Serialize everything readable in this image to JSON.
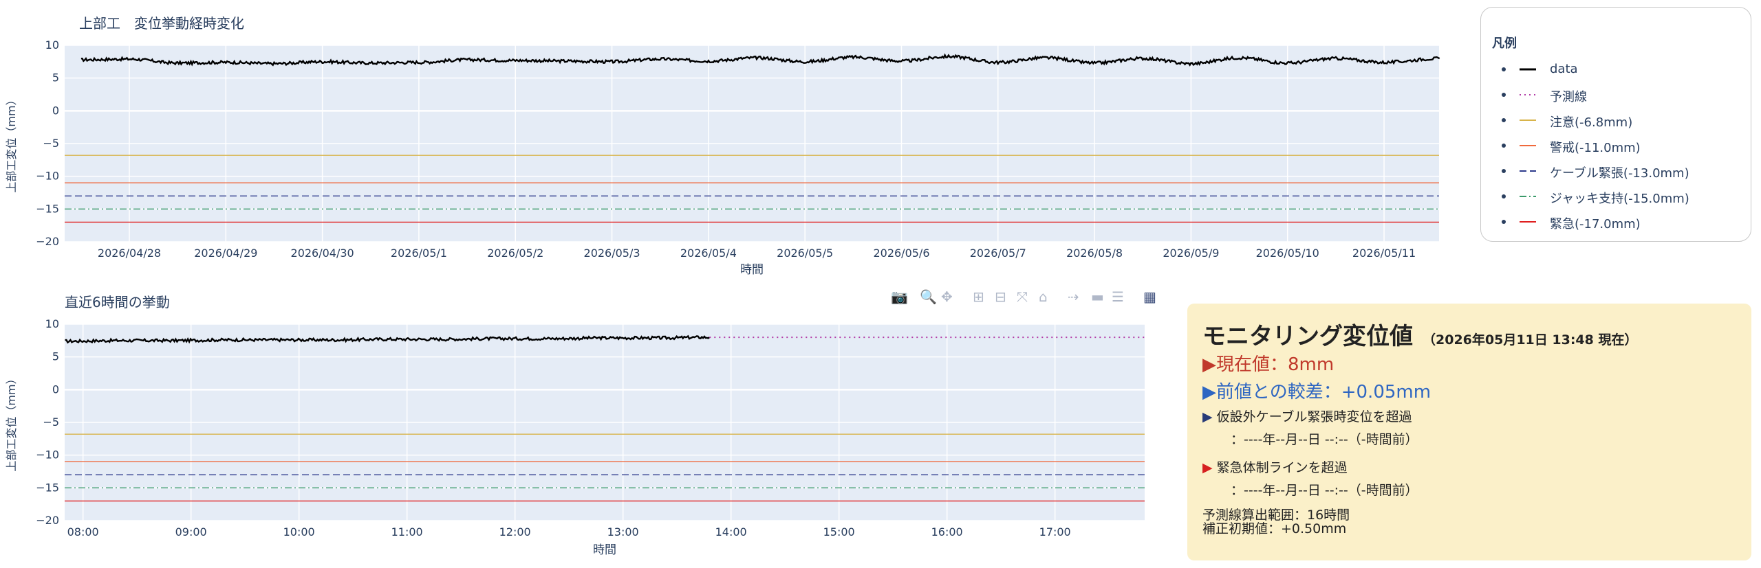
{
  "top_chart": {
    "title": "上部工　変位挙動経時変化",
    "ylabel": "上部工変位（mm）",
    "xlabel": "時間"
  },
  "bottom_chart": {
    "title": "直近6時間の挙動",
    "ylabel": "上部工変位（mm）",
    "xlabel": "時間"
  },
  "legend": {
    "title": "凡例",
    "items": [
      {
        "label": "data",
        "color": "#000000",
        "dash": "solid"
      },
      {
        "label": "予測線",
        "color": "#b23aa6",
        "dash": "dot"
      },
      {
        "label": "注意(-6.8mm)",
        "color": "#d8b44a",
        "dash": "solid"
      },
      {
        "label": "警戒(-11.0mm)",
        "color": "#f0693c",
        "dash": "solid"
      },
      {
        "label": "ケーブル緊張(-13.0mm)",
        "color": "#2d3a8c",
        "dash": "dash"
      },
      {
        "label": "ジャッキ支持(-15.0mm)",
        "color": "#3a9a6a",
        "dash": "dashdot"
      },
      {
        "label": "緊急(-17.0mm)",
        "color": "#e02020",
        "dash": "solid"
      }
    ]
  },
  "modebar": {
    "icons": [
      "camera-icon",
      "zoom-icon",
      "pan-icon",
      "zoom-in-icon",
      "zoom-out-icon",
      "autoscale-icon",
      "reset-axes-icon",
      "spike-lines-icon",
      "hover-closest-icon",
      "hover-compare-icon",
      "plotly-logo-icon"
    ]
  },
  "monitor": {
    "title": "モニタリング変位値",
    "timestamp": "（2026年05月11日 13:48 現在）",
    "current": "▶現在値：8mm",
    "diff": "▶前値との較差：+0.05mm",
    "exceed1_label": "仮設外ケーブル緊張時変位を超過",
    "exceed1_time": "　：----年--月--日 --:--（-時間前）",
    "exceed2_label": "緊急体制ラインを超過",
    "exceed2_time": "　：----年--月--日 --:--（-時間前）",
    "footer1": "予測線算出範囲：16時間",
    "footer2": "補正初期値：+0.50mm"
  },
  "chart_data": [
    {
      "type": "line",
      "title": "上部工　変位挙動経時変化",
      "xlabel": "時間",
      "ylabel": "上部工変位（mm）",
      "ylim": [
        -20,
        10
      ],
      "yticks": [
        10,
        5,
        0,
        -5,
        -10,
        -15,
        -20
      ],
      "xticks": [
        "2026/04/28",
        "2026/04/29",
        "2026/04/30",
        "2026/05/1",
        "2026/05/2",
        "2026/05/3",
        "2026/05/4",
        "2026/05/5",
        "2026/05/6",
        "2026/05/7",
        "2026/05/8",
        "2026/05/9",
        "2026/05/10",
        "2026/05/11"
      ],
      "grid": true,
      "series": [
        {
          "name": "data",
          "color": "#000000",
          "x": [
            "2026/04/27 12:00",
            "2026/04/28 00:00",
            "2026/04/28 12:00",
            "2026/04/29 00:00",
            "2026/04/29 12:00",
            "2026/04/30 00:00",
            "2026/04/30 12:00",
            "2026/05/1 00:00",
            "2026/05/1 12:00",
            "2026/05/2 00:00",
            "2026/05/2 12:00",
            "2026/05/3 00:00",
            "2026/05/3 12:00",
            "2026/05/4 00:00",
            "2026/05/4 12:00",
            "2026/05/5 00:00",
            "2026/05/5 12:00",
            "2026/05/6 00:00",
            "2026/05/6 12:00",
            "2026/05/7 00:00",
            "2026/05/7 12:00",
            "2026/05/8 00:00",
            "2026/05/8 12:00",
            "2026/05/9 00:00",
            "2026/05/9 12:00",
            "2026/05/10 00:00",
            "2026/05/10 12:00",
            "2026/05/11 00:00",
            "2026/05/11 13:48"
          ],
          "y": [
            7.8,
            7.9,
            7.3,
            7.4,
            7.2,
            7.5,
            7.3,
            7.4,
            7.8,
            7.7,
            7.6,
            7.5,
            7.9,
            7.6,
            8.1,
            7.5,
            8.2,
            7.6,
            8.3,
            7.4,
            8.1,
            7.3,
            8.0,
            7.2,
            8.1,
            7.3,
            8.0,
            7.4,
            8.0
          ]
        }
      ],
      "thresholds": [
        {
          "name": "注意(-6.8mm)",
          "value": -6.8
        },
        {
          "name": "警戒(-11.0mm)",
          "value": -11.0
        },
        {
          "name": "ケーブル緊張(-13.0mm)",
          "value": -13.0
        },
        {
          "name": "ジャッキ支持(-15.0mm)",
          "value": -15.0
        },
        {
          "name": "緊急(-17.0mm)",
          "value": -17.0
        }
      ]
    },
    {
      "type": "line",
      "title": "直近6時間の挙動",
      "xlabel": "時間",
      "ylabel": "上部工変位（mm）",
      "ylim": [
        -20,
        10
      ],
      "yticks": [
        10,
        5,
        0,
        -5,
        -10,
        -15,
        -20
      ],
      "xticks": [
        "08:00",
        "09:00",
        "10:00",
        "11:00",
        "12:00",
        "13:00",
        "14:00",
        "15:00",
        "16:00",
        "17:00"
      ],
      "grid": true,
      "series": [
        {
          "name": "data",
          "color": "#000000",
          "x": [
            "07:50",
            "08:20",
            "08:50",
            "09:20",
            "09:50",
            "10:20",
            "10:50",
            "11:20",
            "11:50",
            "12:20",
            "12:50",
            "13:20",
            "13:48"
          ],
          "y": [
            7.4,
            7.5,
            7.5,
            7.6,
            7.6,
            7.6,
            7.7,
            7.7,
            7.8,
            7.8,
            7.9,
            7.9,
            8.0
          ]
        },
        {
          "name": "予測線",
          "color": "#b23aa6",
          "x": [
            "13:48",
            "14:30",
            "15:30",
            "16:30",
            "17:30",
            "17:50"
          ],
          "y": [
            8.0,
            8.0,
            8.0,
            8.0,
            8.0,
            8.0
          ]
        }
      ],
      "thresholds": [
        {
          "name": "注意(-6.8mm)",
          "value": -6.8
        },
        {
          "name": "警戒(-11.0mm)",
          "value": -11.0
        },
        {
          "name": "ケーブル緊張(-13.0mm)",
          "value": -13.0
        },
        {
          "name": "ジャッキ支持(-15.0mm)",
          "value": -15.0
        },
        {
          "name": "緊急(-17.0mm)",
          "value": -17.0
        }
      ]
    }
  ]
}
